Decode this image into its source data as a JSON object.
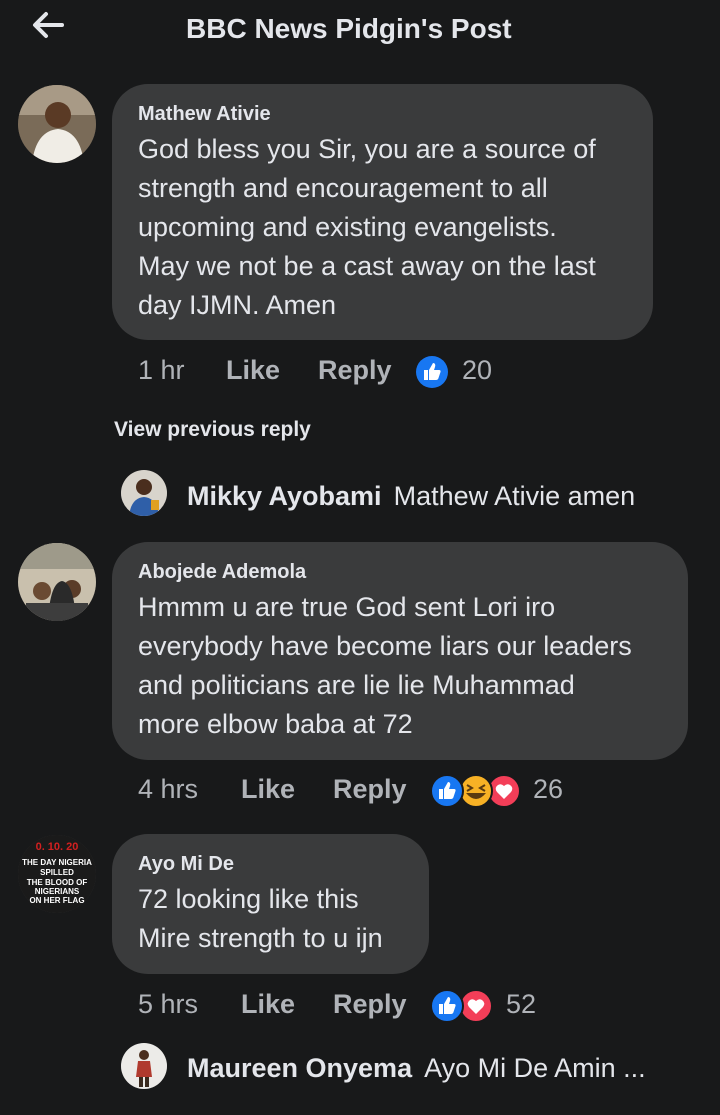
{
  "header": {
    "title": "BBC News Pidgin's Post",
    "back_icon": "back-arrow-icon"
  },
  "comments": [
    {
      "author": "Mathew Ativie",
      "lines": [
        "God bless you Sir, you are a source of",
        "strength and encouragement to all",
        "upcoming and existing  evangelists.",
        "May we not be a cast away on the last",
        "day IJMN. Amen"
      ],
      "time": "1 hr",
      "like": "Like",
      "reply": "Reply",
      "reactions": [
        "like-icon"
      ],
      "reaction_count": "20"
    },
    {
      "author": "Abojede Ademola",
      "lines": [
        "Hmmm u are true God sent Lori iro",
        "everybody have become liars our leaders",
        "and politicians are lie lie Muhammad",
        "more elbow baba at 72"
      ],
      "time": "4 hrs",
      "like": "Like",
      "reply": "Reply",
      "reactions": [
        "like-icon",
        "haha-icon",
        "love-icon"
      ],
      "reaction_count": "26"
    },
    {
      "author": "Ayo Mi De",
      "lines": [
        "72 looking like this",
        "Mire strength to u ijn"
      ],
      "time": "5 hrs",
      "like": "Like",
      "reply": "Reply",
      "reactions": [
        "like-icon",
        "love-icon"
      ],
      "reaction_count": "52"
    }
  ],
  "view_previous": "View previous reply",
  "replies": [
    {
      "author": "Mikky Ayobami",
      "text": "Mathew Ativie amen"
    },
    {
      "author": "Maureen Onyema",
      "text": "Ayo Mi De Amin ..."
    }
  ],
  "avatar_text": {
    "ayo_mi_de": [
      "0. 10. 20",
      "THE DAY NIGERIA",
      "SPILLED",
      "THE BLOOD OF",
      "NIGERIANS",
      "ON HER FLAG"
    ]
  },
  "colors": {
    "background": "#18191a",
    "bubble": "#3a3b3c",
    "like_blue": "#1877f2",
    "love_red": "#f33e58",
    "haha_yellow": "#f7b125",
    "muted_text": "#b0b3b8"
  }
}
